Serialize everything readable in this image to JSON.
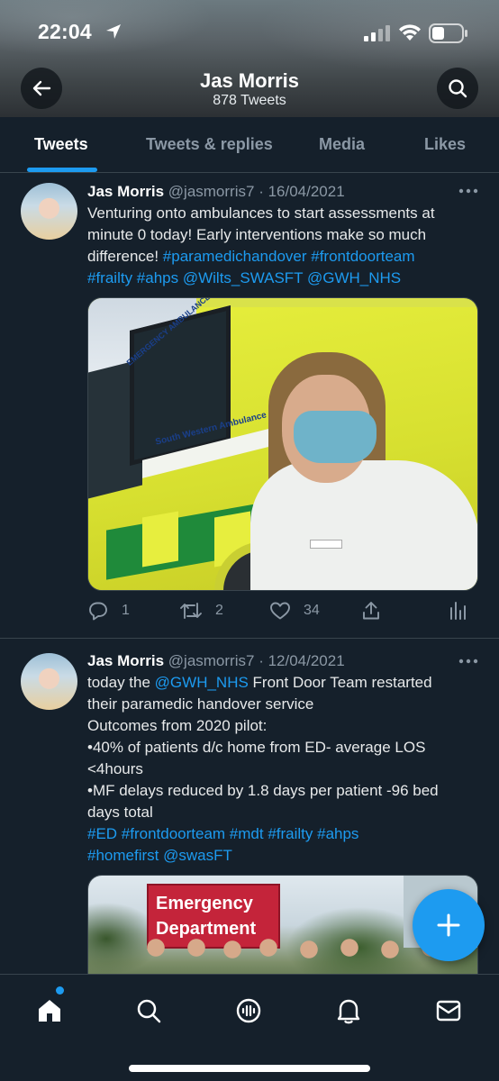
{
  "status_bar": {
    "time": "22:04"
  },
  "header": {
    "title": "Jas Morris",
    "subtitle": "878 Tweets"
  },
  "tabs": [
    {
      "label": "Tweets",
      "active": true
    },
    {
      "label": "Tweets & replies",
      "active": false
    },
    {
      "label": "Media",
      "active": false
    },
    {
      "label": "Likes",
      "active": false
    }
  ],
  "tweets": [
    {
      "name": "Jas Morris",
      "handle": "@jasmorris7",
      "date": "· 16/04/2021",
      "lines": [
        {
          "text": "Venturing onto ambulances to start assessments at"
        },
        {
          "text": "minute 0 today! Early interventions make so much"
        },
        {
          "pre": "difference! ",
          "link": "#paramedichandover #frontdoorteam"
        },
        {
          "link": "#frailty #ahps @Wilts_SWASFT @GWH_NHS"
        }
      ],
      "media_labels": [
        "EMERGENCY AMBULANCE",
        "South Western Ambulance Service NHS"
      ],
      "stats": {
        "replies": "1",
        "retweets": "2",
        "likes": "34"
      }
    },
    {
      "name": "Jas Morris",
      "handle": "@jasmorris7",
      "date": "· 12/04/2021",
      "lines": [
        {
          "pre": "today the ",
          "link": "@GWH_NHS",
          "post": " Front Door Team restarted"
        },
        {
          "text": "their paramedic handover service"
        },
        {
          "text": "Outcomes from 2020 pilot:"
        },
        {
          "text": "•40% of patients d/c home from ED- average LOS"
        },
        {
          "text": "<4hours"
        },
        {
          "text": "•MF delays reduced by 1.8 days per patient -96 bed"
        },
        {
          "text": "days total"
        },
        {
          "link": "#ED #frontdoorteam #mdt #frailty #ahps"
        },
        {
          "link": "#homefirst @swasFT"
        }
      ],
      "media_labels": [
        "Emergency",
        "Department"
      ]
    }
  ],
  "colors": {
    "background": "#15202b",
    "accent": "#1d9bf0",
    "muted": "#8b98a5",
    "divider": "#38444d"
  },
  "icons": [
    "location-arrow-icon",
    "signal-icon",
    "wifi-icon",
    "battery-icon",
    "back-arrow-icon",
    "search-icon",
    "more-icon",
    "reply-icon",
    "retweet-icon",
    "like-icon",
    "share-icon",
    "analytics-icon",
    "compose-icon",
    "home-icon",
    "explore-icon",
    "spaces-icon",
    "notifications-icon",
    "messages-icon"
  ]
}
